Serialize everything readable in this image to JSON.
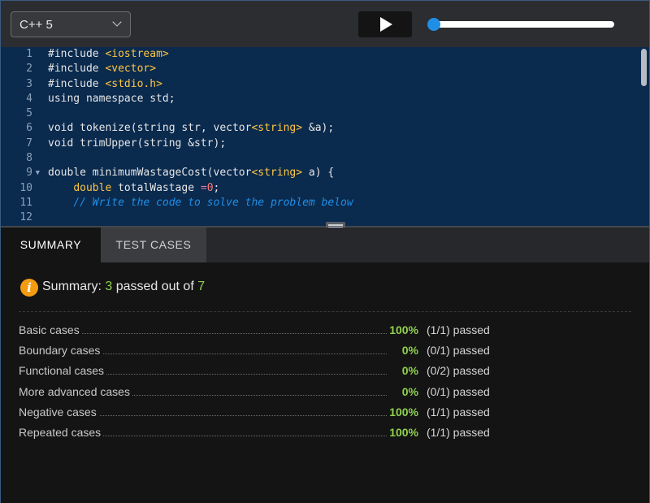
{
  "toolbar": {
    "language": "C++ 5"
  },
  "editor": {
    "line_numbers": [
      "1",
      "2",
      "3",
      "4",
      "5",
      "6",
      "7",
      "8",
      "9",
      "10",
      "11",
      "12"
    ],
    "lines": {
      "l1": {
        "kw": "#include ",
        "arg": "<iostream>"
      },
      "l2": {
        "kw": "#include ",
        "arg": "<vector>"
      },
      "l3": {
        "kw": "#include ",
        "arg": "<stdio.h>"
      },
      "l4": {
        "text": "using namespace std;"
      },
      "l6": {
        "a": "void tokenize(string str, vector",
        "b": "<string>",
        "c": " &a);"
      },
      "l7": {
        "text": "void trimUpper(string &str);"
      },
      "l9": {
        "a": "double minimumWastageCost(vector",
        "b": "<string>",
        "c": " a) {"
      },
      "l10": {
        "kw": "double",
        "mid": " totalWastage ",
        "eq": "=",
        "num": "0",
        "end": ";"
      },
      "l11": {
        "comment": "// Write the code to solve the problem below"
      }
    }
  },
  "tabs": {
    "summary": "SUMMARY",
    "test_cases": "TEST CASES"
  },
  "summary": {
    "prefix": "Summary: ",
    "passed": "3",
    "middle": " passed out of ",
    "total": "7",
    "rows": [
      {
        "label": "Basic cases",
        "pct": "100%",
        "result": "(1/1) passed"
      },
      {
        "label": "Boundary cases",
        "pct": "0%",
        "result": "(0/1) passed"
      },
      {
        "label": "Functional cases",
        "pct": "0%",
        "result": "(0/2) passed"
      },
      {
        "label": "More advanced cases",
        "pct": "0%",
        "result": "(0/1) passed"
      },
      {
        "label": "Negative cases",
        "pct": "100%",
        "result": "(1/1) passed"
      },
      {
        "label": "Repeated cases",
        "pct": "100%",
        "result": "(1/1) passed"
      }
    ]
  },
  "colors": {
    "editor_bg": "#0a2a4e",
    "accent": "#1f8fe6",
    "pass_green": "#8fd14f",
    "info_orange": "#f39c12"
  }
}
